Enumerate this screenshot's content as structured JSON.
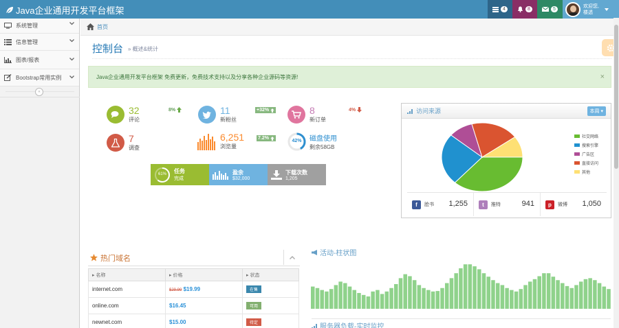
{
  "brand": {
    "title": "Java企业通用开发平台框架"
  },
  "navbar": {
    "tasks_count": "4",
    "notifications_count": "8",
    "messages_count": "5",
    "user_welcome": "欢迎您,",
    "user_name": "楼透"
  },
  "sidebar": {
    "items": [
      {
        "label": "系统管理",
        "icon": "desktop-icon"
      },
      {
        "label": "信息管理",
        "icon": "list-icon"
      },
      {
        "label": "图表/报表",
        "icon": "bar-chart-icon"
      },
      {
        "label": "Bootstrap常用实例",
        "icon": "edit-icon"
      }
    ]
  },
  "breadcrumb": {
    "home": "首页"
  },
  "page": {
    "title": "控制台",
    "subtitle": "» 概述&统计"
  },
  "alert": {
    "text": "Java企业通用开发平台框架 免费更新，免费技术支持以及分享各种企业源码等资源!",
    "close": "×"
  },
  "stats": [
    {
      "value": "32",
      "label": "评论",
      "change": "8%",
      "trend": "up"
    },
    {
      "value": "11",
      "label": "新粉丝",
      "change": "+32%",
      "trend": "up"
    },
    {
      "value": "8",
      "label": "新订单",
      "change": "4%",
      "trend": "down"
    },
    {
      "value": "7",
      "label": "调查"
    },
    {
      "value": "6,251",
      "label": "浏览量",
      "change": "7.2%",
      "trend": "up"
    },
    {
      "value": "磁盘使用",
      "label": "剩余58GB",
      "percent": "42%"
    }
  ],
  "tiles": [
    {
      "title": "任务",
      "sub": "完成",
      "percent": "61%",
      "color": "#9abc32"
    },
    {
      "title": "盈余",
      "sub": "$32,000",
      "color": "#6fb3e0"
    },
    {
      "title": "下载次数",
      "sub": "1,205",
      "color": "#a0a0a0"
    }
  ],
  "traffic": {
    "title": "访问来源",
    "button": "本周",
    "legend": [
      {
        "label": "社交网络",
        "color": "#68bc31"
      },
      {
        "label": "搜索引擎",
        "color": "#2091cf"
      },
      {
        "label": "广告区",
        "color": "#af4e96"
      },
      {
        "label": "直接访问",
        "color": "#da5430"
      },
      {
        "label": "其他",
        "color": "#fee074"
      }
    ],
    "slice_values": [
      0.367,
      0.244,
      0.098,
      0.191,
      0.1
    ],
    "social": [
      {
        "name": "脸书",
        "value": "1,255",
        "color": "#3b5998",
        "glyph": "f"
      },
      {
        "name": "推特",
        "value": "941",
        "color": "#ae7fbb",
        "glyph": "t"
      },
      {
        "name": "微博",
        "value": "1,050",
        "color": "#cb2027",
        "glyph": "p"
      }
    ]
  },
  "domains": {
    "title": "热门域名",
    "headers": [
      "名称",
      "价格",
      "状态"
    ],
    "rows": [
      {
        "name": "internet.com",
        "old_price": "$29.99",
        "price": "$19.99",
        "status": "在售",
        "status_color": "#3a87ad"
      },
      {
        "name": "online.com",
        "old_price": "",
        "price": "$16.45",
        "status": "可用",
        "status_color": "#82af6f"
      },
      {
        "name": "newnet.com",
        "old_price": "",
        "price": "$15.00",
        "status": "待定",
        "status_color": "#d15b47"
      }
    ]
  },
  "activity": {
    "title": "活动-柱状图",
    "title2": "服务器负载-实时监控",
    "bar_levels": [
      0.45,
      0.42,
      0.38,
      0.35,
      0.4,
      0.48,
      0.55,
      0.52,
      0.45,
      0.38,
      0.32,
      0.28,
      0.25,
      0.35,
      0.38,
      0.3,
      0.35,
      0.42,
      0.5,
      0.62,
      0.7,
      0.66,
      0.58,
      0.48,
      0.42,
      0.38,
      0.35,
      0.36,
      0.42,
      0.52,
      0.62,
      0.72,
      0.82,
      0.9,
      0.9,
      0.86,
      0.8,
      0.72,
      0.65,
      0.58,
      0.52,
      0.48,
      0.42,
      0.38,
      0.35,
      0.4,
      0.48,
      0.55,
      0.6,
      0.66,
      0.72,
      0.72,
      0.65,
      0.58,
      0.52,
      0.46,
      0.42,
      0.48,
      0.55,
      0.6,
      0.62,
      0.58,
      0.52,
      0.45,
      0.4
    ]
  }
}
